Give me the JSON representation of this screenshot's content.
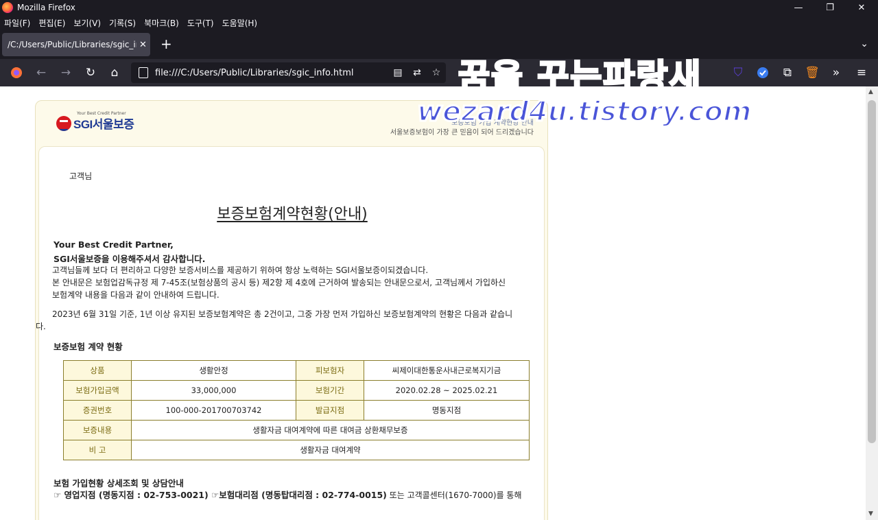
{
  "window": {
    "title": "Mozilla Firefox",
    "minimize": "—",
    "maximize": "❐",
    "close": "✕"
  },
  "menu": [
    "파일(F)",
    "편집(E)",
    "보기(V)",
    "기록(S)",
    "북마크(B)",
    "도구(T)",
    "도움말(H)"
  ],
  "tab": {
    "title": "/C:/Users/Public/Libraries/sgic_info",
    "close": "✕",
    "new": "+",
    "list": "⌄"
  },
  "nav": {
    "url": "file:///C:/Users/Public/Libraries/sgic_info.html"
  },
  "page": {
    "logo_tagline": "Your Best Credit Partner",
    "logo_name": "SGI서울보증",
    "header_line1": "보증보험 가입 계약현황 안내",
    "header_line2": "서울보증보험이 가장 큰 믿음이 되어 드리겠습니다",
    "greeting": "고객님",
    "title": "보증보험계약현황(안내)",
    "intro_bold1": "Your Best Credit Partner,",
    "intro_bold2": "SGI서울보증을 이용해주셔서 감사합니다.",
    "para1": "고객님들께 보다 더 편리하고 다양한 보증서비스를 제공하기 위하여 항상 노력하는 SGI서울보증이되겠습니다.",
    "para2a": "본 안내문은 보험업감독규정 제 7-45조(보험상품의 공시 등) 제2항 제 4호에 근거하여 발송되는 안내문으로서, 고객님께서 가입하신",
    "para2b": "보험계약 내용을 다음과 같이 안내하여 드립니다.",
    "para3a": "2023년 6월 31일 기준, 1년 이상 유지된 보증보험계약은 총 2건이고, 그중 가장 먼저 가입하신 보증보험계약의 현황은 다음과 같습니",
    "para3b": "다.",
    "section1": "보증보험 계약 현황",
    "table": {
      "product_label": "상품",
      "product": "생활안정",
      "insured_label": "피보험자",
      "insured": "씨제이대한통운사내근로복지기금",
      "amount_label": "보험가입금액",
      "amount": "33,000,000",
      "period_label": "보험기간",
      "period": "2020.02.28 ~ 2025.02.21",
      "cert_label": "증권번호",
      "cert": "100-000-201700703742",
      "branch_label": "발급지점",
      "branch": "명동지점",
      "content_label": "보증내용",
      "content": "생활자금 대여계약에 따른 대여금 상환채무보증",
      "remark_label": "비 고",
      "remark": "생활자금 대여계약"
    },
    "section2": "보험 가입현황 상세조회 및 상담안내",
    "contact_bold": "☞ 영업지점 (명동지점 : 02-753-0021) ☞보험대리점 (명동탑대리점 : 02-774-0015)",
    "contact_rest": " 또는 고객콜센터(1670-7000)를 통해"
  },
  "watermark": {
    "line1": "꿈을 꾸는파랑새",
    "line2": "wezard4u.tistory.com"
  },
  "colors": {
    "chrome": "#1c1b22",
    "toolbar": "#2b2a33",
    "label_bg": "#fdf8dc",
    "table_border": "#8a7d2b",
    "brand_blue": "#1f3a93",
    "brand_red": "#d71920"
  }
}
